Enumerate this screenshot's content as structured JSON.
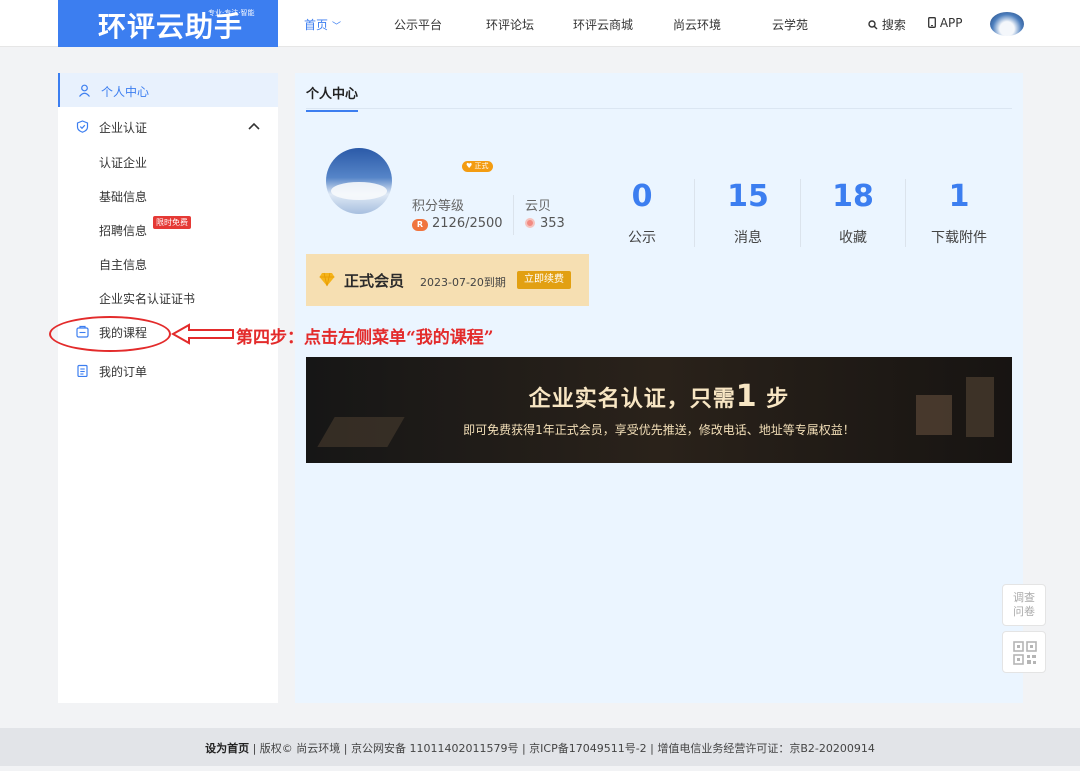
{
  "header": {
    "logo_text": "环评云助手",
    "logo_tagline": "专业·专注·智能",
    "nav": [
      {
        "label": "首页",
        "active": true
      },
      {
        "label": "公示平台"
      },
      {
        "label": "环评论坛"
      },
      {
        "label": "环评云商城"
      },
      {
        "label": "尚云环境"
      },
      {
        "label": "云学苑"
      }
    ],
    "search_label": "搜索",
    "app_label": "APP"
  },
  "sidebar": {
    "personal_center": "个人中心",
    "enterprise_cert": "企业认证",
    "sub_items": [
      "认证企业",
      "基础信息",
      "招聘信息",
      "自主信息",
      "企业实名认证证书"
    ],
    "recruit_badge": "限时免费",
    "my_courses": "我的课程",
    "my_orders": "我的订单"
  },
  "main": {
    "tab_label": "个人中心",
    "member_tag": "正式",
    "level_label": "积分等级",
    "level_icon_text": "R",
    "level_value": "2126/2500",
    "coin_label": "云贝",
    "coin_value": "353",
    "stats": [
      {
        "num": "0",
        "label": "公示"
      },
      {
        "num": "15",
        "label": "消息"
      },
      {
        "num": "18",
        "label": "收藏"
      },
      {
        "num": "1",
        "label": "下载附件"
      }
    ],
    "membership": {
      "title": "正式会员",
      "expiry": "2023-07-20到期",
      "renew_button": "立即续费"
    },
    "banner": {
      "title_pre": "企业实名认证，只需",
      "title_num": "1",
      "title_post": "步",
      "subtitle": "即可免费获得1年正式会员，享受优先推送，修改电话、地址等专属权益！"
    }
  },
  "annotation": {
    "text": "第四步：点击左侧菜单“我的课程”",
    "color": "#e32b2b"
  },
  "float_tools": {
    "survey_line1": "调查",
    "survey_line2": "问卷"
  },
  "footer": {
    "set_home": "设为首页",
    "rest": " | 版权© 尚云环境 | 京公网安备 11011402011579号 | 京ICP备17049511号-2 | 增值电信业务经营许可证：京B2-20200914"
  },
  "colors": {
    "accent": "#3c7ef0",
    "main_bg": "#ebf5ff",
    "member_bg": "#f6dfb2",
    "renew_button": "#e2a012"
  }
}
